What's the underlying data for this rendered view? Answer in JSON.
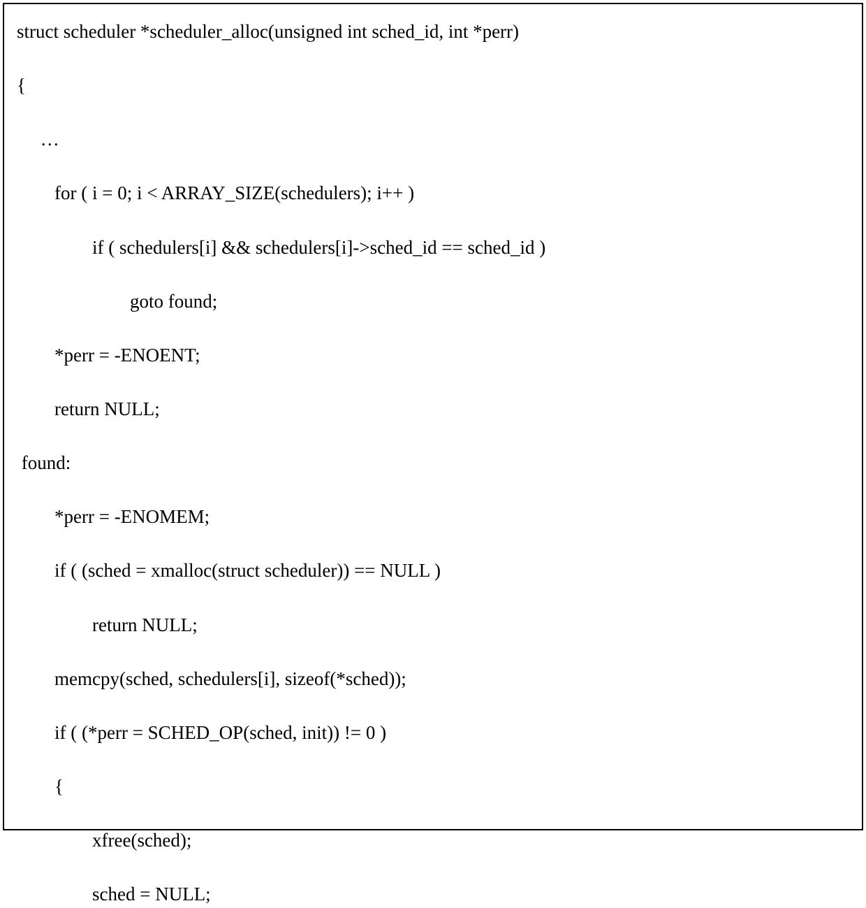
{
  "code": {
    "lines": [
      "struct scheduler *scheduler_alloc(unsigned int sched_id, int *perr)",
      "{",
      "     …",
      "        for ( i = 0; i < ARRAY_SIZE(schedulers); i++ )",
      "                if ( schedulers[i] && schedulers[i]->sched_id == sched_id )",
      "                        goto found;",
      "        *perr = -ENOENT;",
      "        return NULL;",
      " found:",
      "        *perr = -ENOMEM;",
      "        if ( (sched = xmalloc(struct scheduler)) == NULL )",
      "                return NULL;",
      "        memcpy(sched, schedulers[i], sizeof(*sched));",
      "        if ( (*perr = SCHED_OP(sched, init)) != 0 )",
      "        {",
      "                xfree(sched);",
      "                sched = NULL;"
    ]
  }
}
